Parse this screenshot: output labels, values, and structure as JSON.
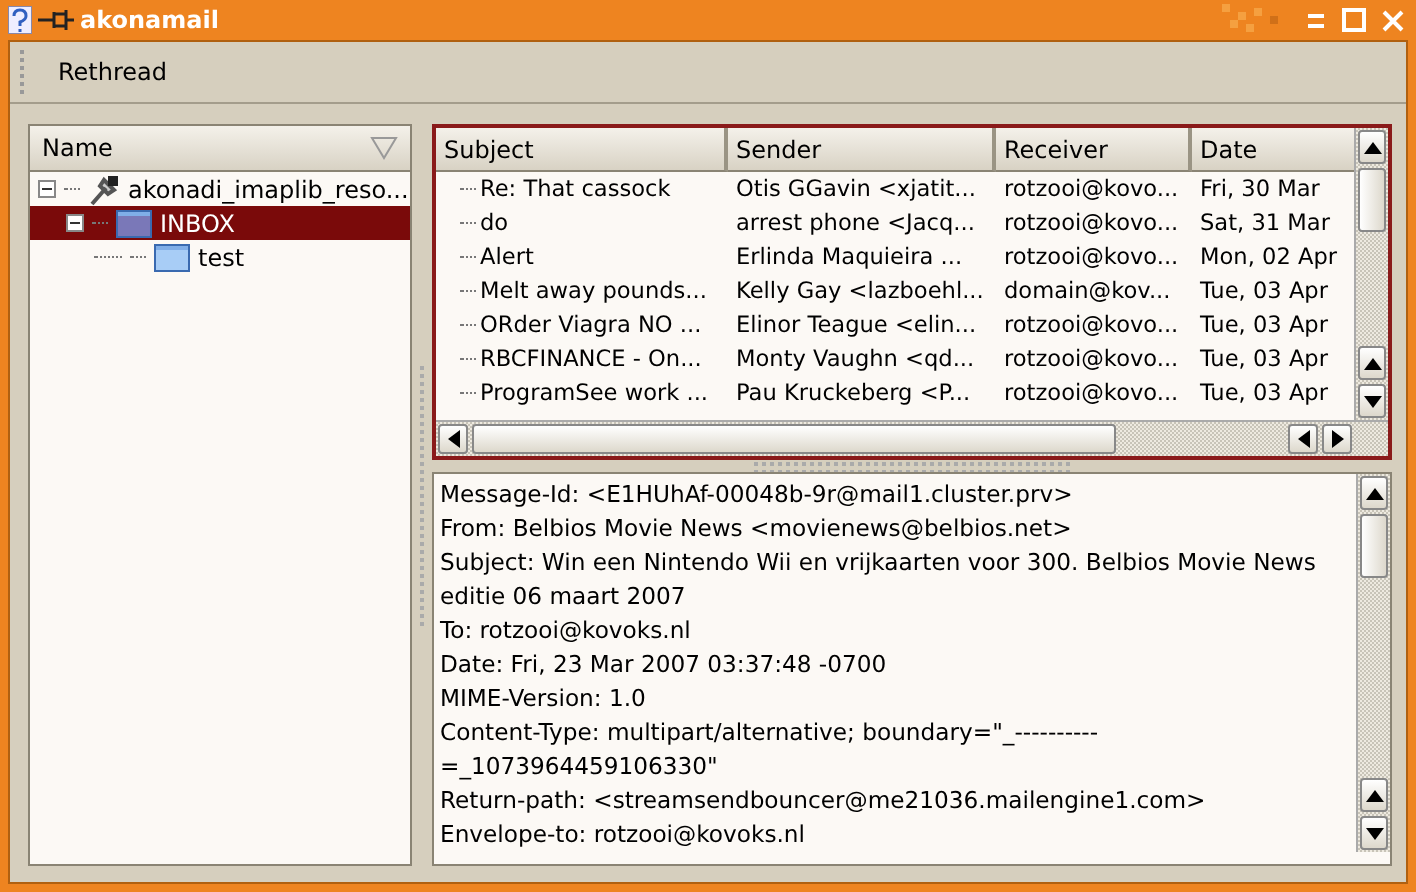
{
  "window": {
    "title": "akonamail"
  },
  "toolbar": {
    "buttons": [
      "Rethread"
    ]
  },
  "folder_tree": {
    "column": "Name",
    "items": [
      {
        "label": "akonadi_imaplib_reso...",
        "kind": "resource",
        "expanded": true,
        "selected": false,
        "children": [
          {
            "label": "INBOX",
            "kind": "folder",
            "expanded": true,
            "selected": true,
            "children": [
              {
                "label": "test",
                "kind": "folder",
                "selected": false
              }
            ]
          }
        ]
      }
    ]
  },
  "message_list": {
    "columns": [
      "Subject",
      "Sender",
      "Receiver",
      "Date"
    ],
    "rows": [
      [
        "Re: That cassock",
        "Otis GGavin <xjatit...",
        "rotzooi@kovo...",
        "Fri, 30 Mar"
      ],
      [
        "do",
        "arrest phone <Jacq...",
        "rotzooi@kovo...",
        "Sat, 31 Mar"
      ],
      [
        "Alert",
        "Erlinda Maquieira ...",
        "rotzooi@kovo...",
        "Mon, 02 Apr"
      ],
      [
        "Melt away pounds...",
        "Kelly Gay <lazboehl...",
        "domain@kov...",
        "Tue, 03 Apr"
      ],
      [
        "ORder Viagra NO ...",
        "Elinor Teague <elin...",
        "rotzooi@kovo...",
        "Tue, 03 Apr"
      ],
      [
        "RBCFINANCE - On...",
        "Monty Vaughn <qd...",
        "rotzooi@kovo...",
        "Tue, 03 Apr"
      ],
      [
        "ProgramSee work ...",
        "Pau Kruckeberg <P...",
        "rotzooi@kovo...",
        "Tue, 03 Apr"
      ]
    ]
  },
  "message_view": {
    "lines": [
      "Message-Id: <E1HUhAf-00048b-9r@mail1.cluster.prv>",
      "From: Belbios Movie News <movienews@belbios.net>",
      "Subject: Win een Nintendo Wii en vrijkaarten voor 300. Belbios Movie News editie 06 maart 2007",
      "To: rotzooi@kovoks.nl",
      "Date: Fri, 23 Mar 2007 03:37:48 -0700",
      "MIME-Version: 1.0",
      "Content-Type: multipart/alternative; boundary=\"_----------=_1073964459106330\"",
      "Return-path: <streamsendbouncer@me21036.mailengine1.com>",
      "Envelope-to: rotzooi@kovoks.nl"
    ]
  }
}
